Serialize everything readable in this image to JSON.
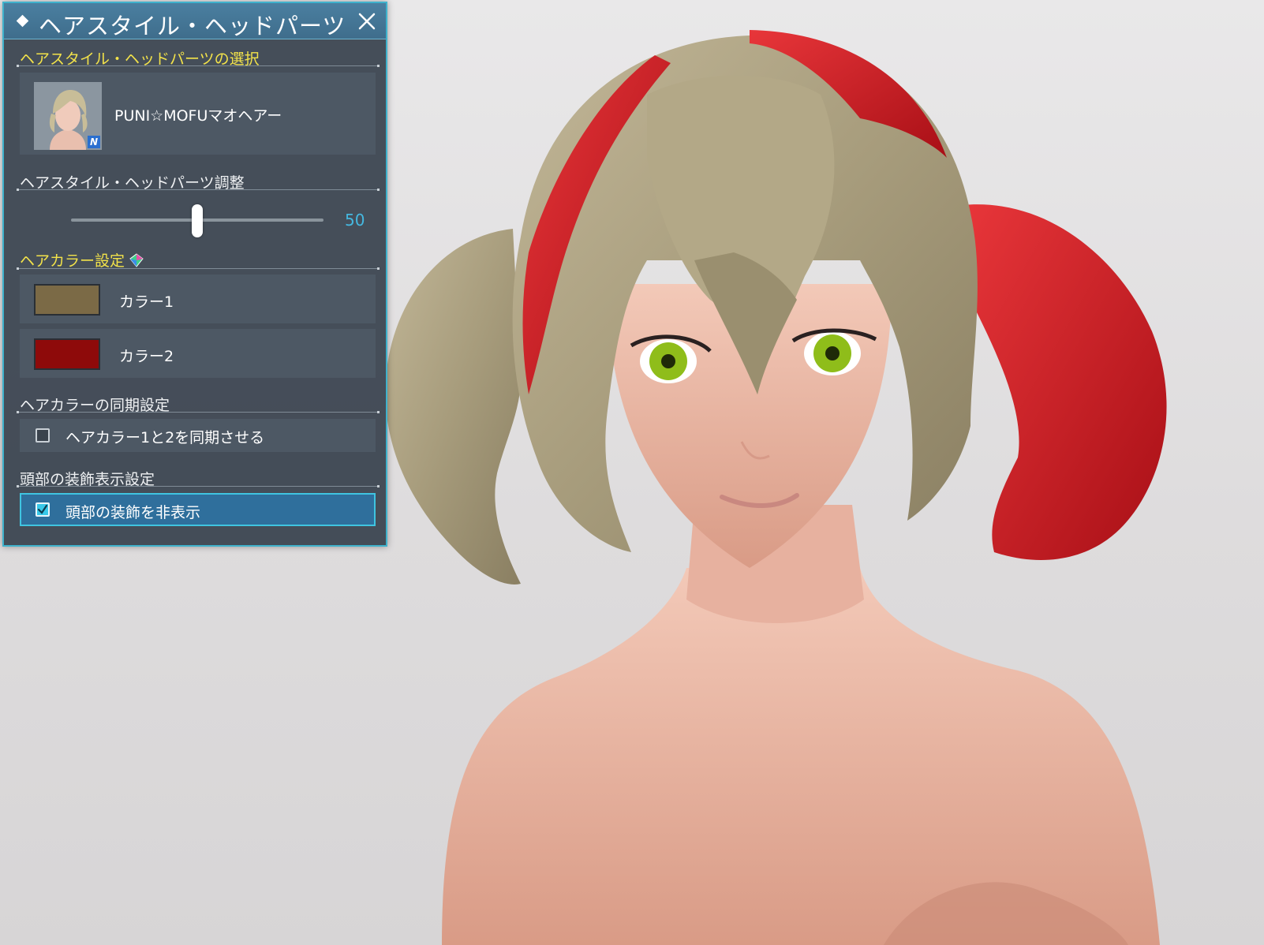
{
  "window": {
    "title": "ヘアスタイル・ヘッドパーツ",
    "close_icon": "close-icon"
  },
  "hairstyle_select": {
    "heading": "ヘアスタイル・ヘッドパーツの選択",
    "selected_name": "PUNI☆MOFUマオヘアー",
    "badge": "N"
  },
  "adjust": {
    "heading": "ヘアスタイル・ヘッドパーツ調整",
    "slider_value": "50",
    "slider_fraction": 0.5
  },
  "hair_color": {
    "heading": "ヘアカラー設定",
    "colors": [
      {
        "label": "カラー1",
        "swatch": "#7b6a46"
      },
      {
        "label": "カラー2",
        "swatch": "#8e0a0a"
      }
    ]
  },
  "sync": {
    "heading": "ヘアカラーの同期設定",
    "checkbox_label": "ヘアカラー1と2を同期させる",
    "checked": false
  },
  "head_decoration": {
    "heading": "頭部の装飾表示設定",
    "checkbox_label": "頭部の装飾を非表示",
    "checked": true
  },
  "colors": {
    "accent": "#3fb2cc",
    "heading_yellow": "#f2e24a",
    "value_blue": "#45b8e0"
  }
}
